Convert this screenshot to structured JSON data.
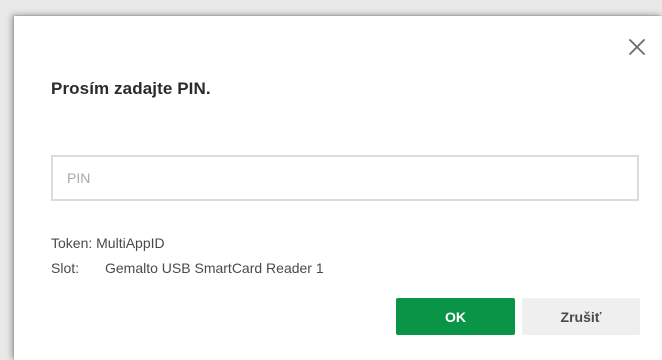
{
  "dialog": {
    "title": "Prosím zadajte PIN.",
    "close_icon": "close-icon",
    "pin_input": {
      "value": "",
      "placeholder": "PIN"
    },
    "token": {
      "label": "Token:",
      "value": "MultiAppID"
    },
    "slot": {
      "label": "Slot:",
      "value": "Gemalto USB SmartCard Reader 1"
    },
    "buttons": {
      "ok_label": "OK",
      "cancel_label": "Zrušiť"
    }
  },
  "colors": {
    "ok_button": "#0a9447",
    "cancel_button": "#efefef",
    "input_border": "#dcdcdc",
    "title_text": "#2b2b2b"
  }
}
